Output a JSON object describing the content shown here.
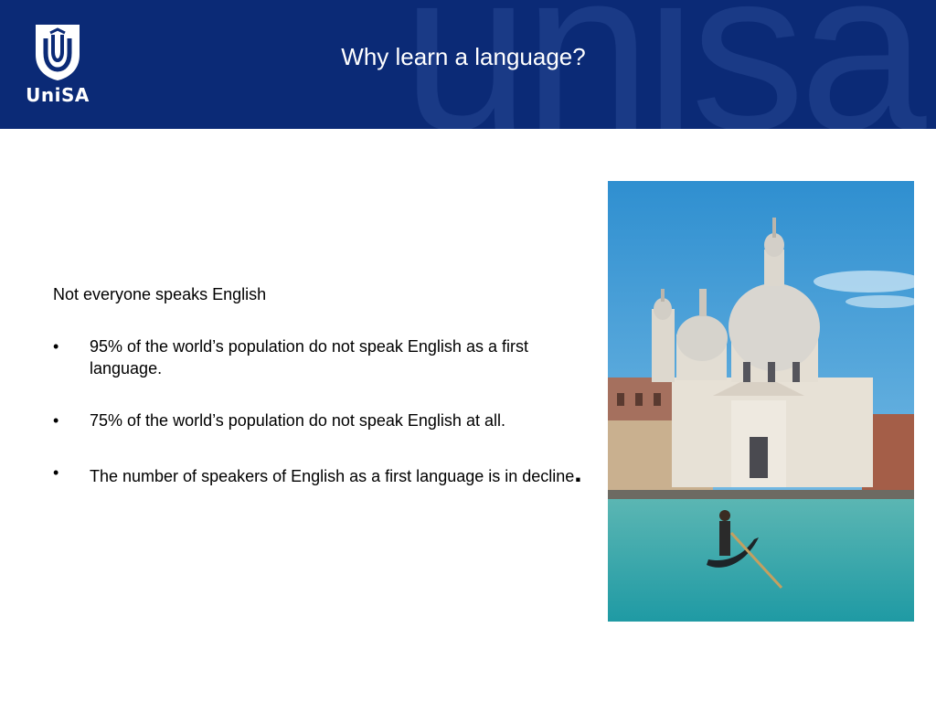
{
  "header": {
    "watermark": "unisa",
    "logo_text": "UniSA",
    "title": "Why learn a language?"
  },
  "content": {
    "intro": "Not everyone speaks English",
    "bullet_char": "•",
    "bullets": [
      "95% of the world’s population do not speak English as a first language.",
      "75% of the world’s population do not speak English at all.",
      "The number of speakers of English as a first language is in decline"
    ],
    "last_punct": "."
  },
  "colors": {
    "header_bg": "#0b2a76",
    "sky": "#3f9bd6",
    "water": "#2fa6a8"
  },
  "image": {
    "subject": "venice-church-gondola-photo"
  }
}
